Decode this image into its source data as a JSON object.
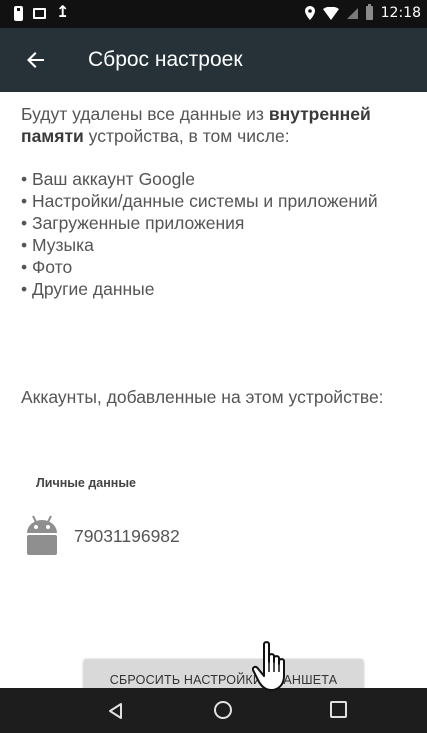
{
  "status_bar": {
    "time": "12:18",
    "left_icons": [
      "phone-icon",
      "image-icon",
      "upload-icon"
    ],
    "right_icons": [
      "location-icon",
      "wifi-icon",
      "signal-icon",
      "battery-icon"
    ]
  },
  "app_bar": {
    "title": "Сброс настроек",
    "back_icon": "arrow-back-icon"
  },
  "content": {
    "intro_part1": "Будут удалены все данные из ",
    "intro_bold": "внутренней памяти",
    "intro_part2": " устройства, в том числе:",
    "items": [
      "Ваш аккаунт Google",
      "Настройки/данные системы и приложений",
      "Загруженные приложения",
      "Музыка",
      "Фото",
      "Другие данные"
    ],
    "accounts_label": "Аккаунты, добавленные на этом устройстве:",
    "section_header": "Личные данные",
    "account": {
      "icon": "android-icon",
      "number": "79031196982"
    }
  },
  "reset_button": {
    "label": "СБРОСИТЬ НАСТРОЙКИ ПЛАНШЕТА"
  },
  "nav_bar": {
    "icons": [
      "nav-back-icon",
      "nav-home-icon",
      "nav-recent-icon"
    ]
  },
  "colors": {
    "app_bar": "#263238",
    "status_bar": "#111111",
    "nav_bar": "#1d1d1d",
    "button": "#d9d9d9",
    "android_green": "#8f8f8f"
  }
}
